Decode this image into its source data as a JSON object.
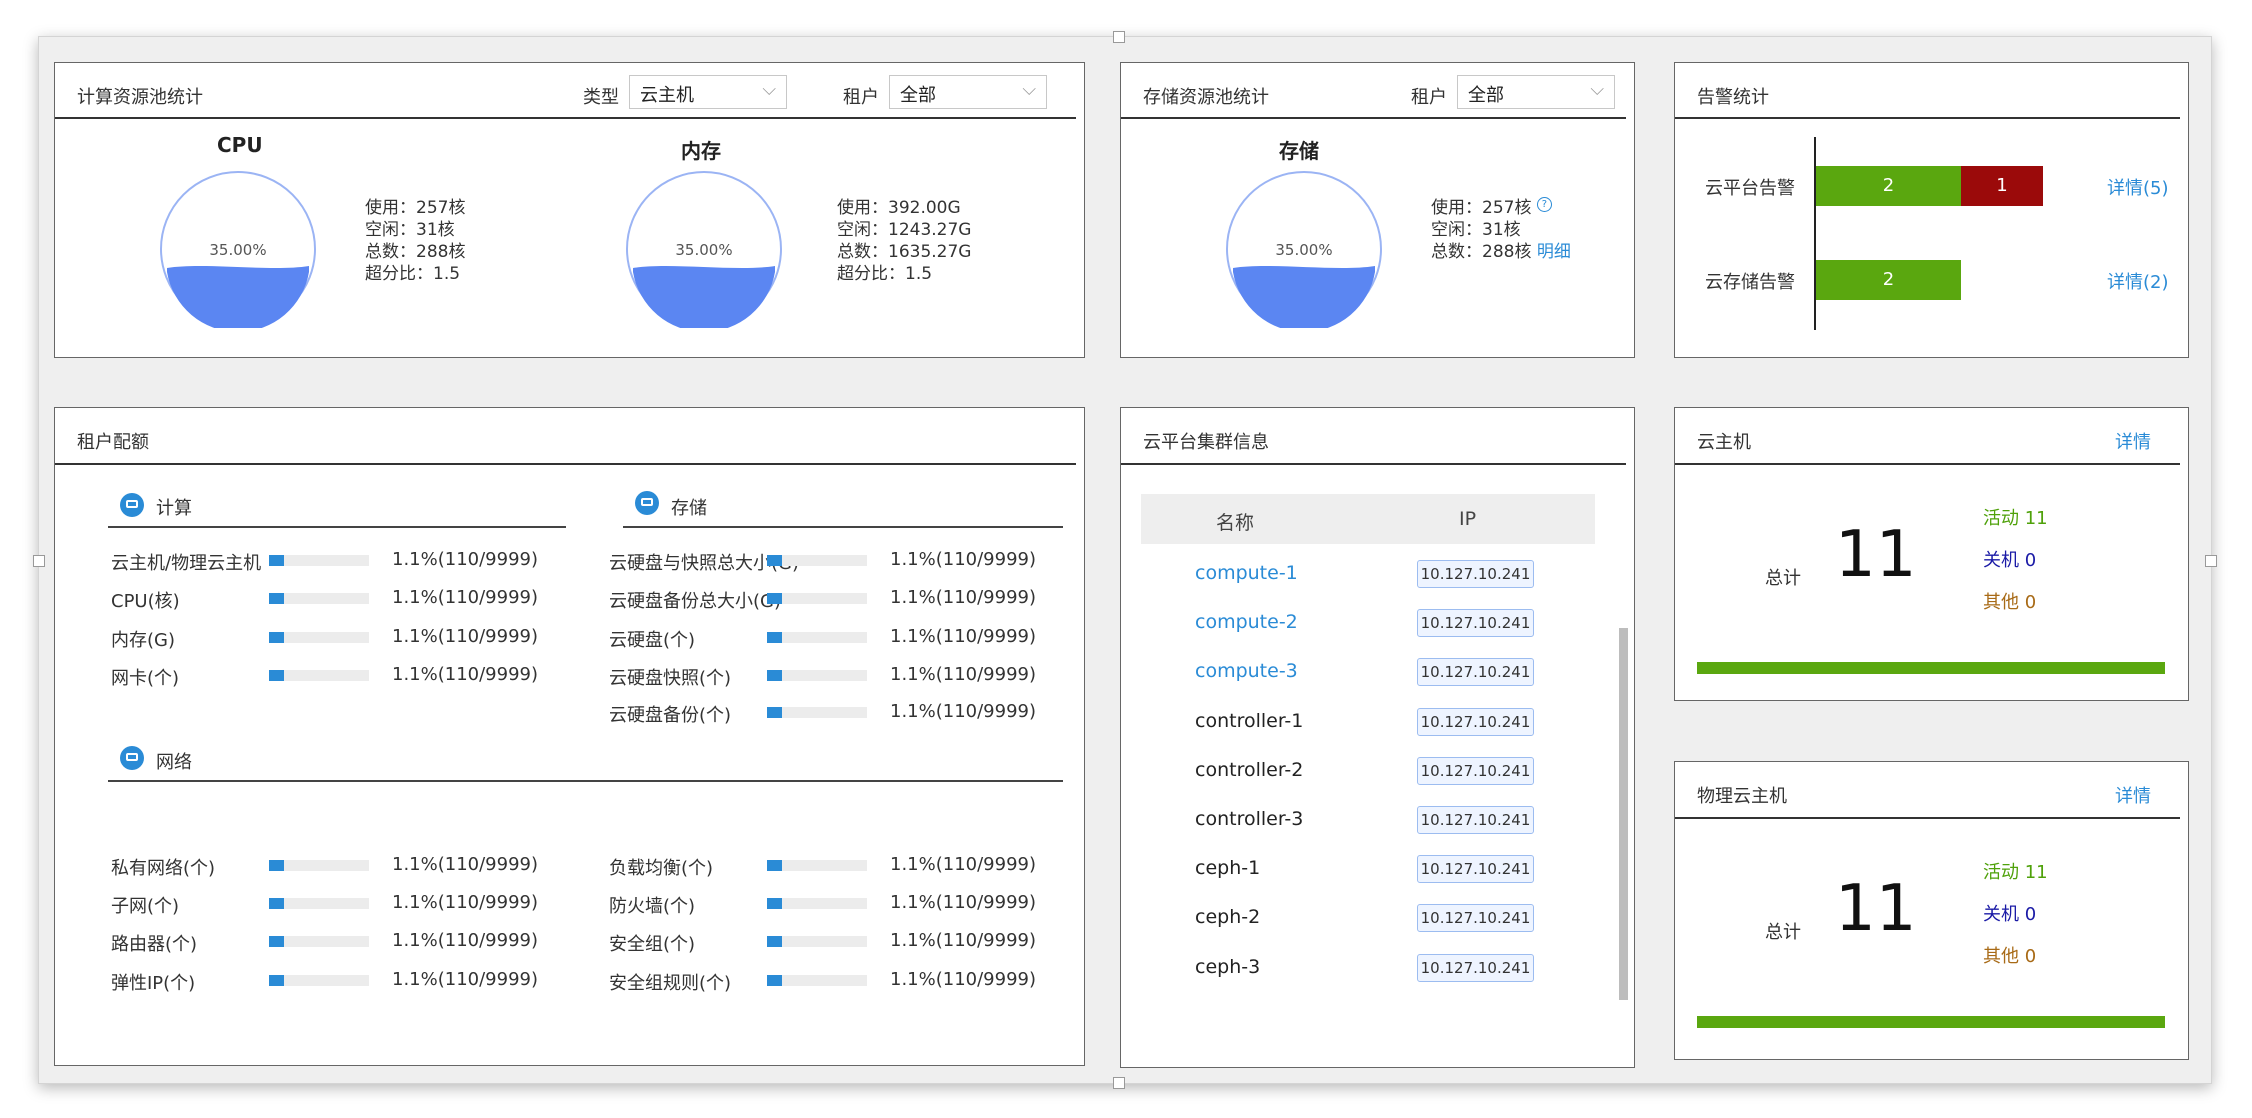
{
  "colors": {
    "accent": "#2a8bd6",
    "green": "#5aa70f",
    "darkred": "#9b0a0a",
    "gauge_fill": "#5b86f2",
    "status_active": "#4fa10a",
    "status_off": "#1a1aa6",
    "status_other": "#a86a16"
  },
  "compute_pool": {
    "title": "计算资源池统计",
    "type_label": "类型",
    "type_value": "云主机",
    "tenant_label": "租户",
    "tenant_value": "全部",
    "cpu": {
      "title": "CPU",
      "percent": "35.00%",
      "fill": 0.35,
      "used": "使用：257核",
      "idle": "空闲：31核",
      "total": "总数：288核",
      "ratio": "超分比：1.5"
    },
    "mem": {
      "title": "内存",
      "percent": "35.00%",
      "fill": 0.35,
      "used": "使用：392.00G",
      "idle": "空闲：1243.27G",
      "total": "总数：1635.27G",
      "ratio": "超分比：1.5"
    }
  },
  "storage_pool": {
    "title": "存储资源池统计",
    "tenant_label": "租户",
    "tenant_value": "全部",
    "storage": {
      "title": "存储",
      "percent": "35.00%",
      "fill": 0.35,
      "used": "使用：257核",
      "idle": "空闲：31核",
      "total": "总数：288核",
      "detail_link": "明细"
    }
  },
  "alerts": {
    "title": "告警统计",
    "rows": [
      {
        "label": "云平台告警",
        "green": 2,
        "red": 1,
        "detail": "详情(5)"
      },
      {
        "label": "云存储告警",
        "green": 2,
        "red": 0,
        "detail": "详情(2)"
      }
    ]
  },
  "quota": {
    "title": "租户配额",
    "compute": {
      "title": "计算",
      "items": [
        {
          "label": "云主机/物理云主机",
          "value": "1.1%(110/9999)",
          "fill": 0.15
        },
        {
          "label": "CPU(核)",
          "value": "1.1%(110/9999)",
          "fill": 0.15
        },
        {
          "label": "内存(G)",
          "value": "1.1%(110/9999)",
          "fill": 0.15
        },
        {
          "label": "网卡(个)",
          "value": "1.1%(110/9999)",
          "fill": 0.15
        }
      ]
    },
    "storage": {
      "title": "存储",
      "items": [
        {
          "label": "云硬盘与快照总大小(G)",
          "value": "1.1%(110/9999)",
          "fill": 0.15
        },
        {
          "label": "云硬盘备份总大小(G)",
          "value": "1.1%(110/9999)",
          "fill": 0.15
        },
        {
          "label": "云硬盘(个)",
          "value": "1.1%(110/9999)",
          "fill": 0.15
        },
        {
          "label": "云硬盘快照(个)",
          "value": "1.1%(110/9999)",
          "fill": 0.15
        },
        {
          "label": "云硬盘备份(个)",
          "value": "1.1%(110/9999)",
          "fill": 0.15
        }
      ]
    },
    "network": {
      "title": "网络",
      "left": [
        {
          "label": "私有网络(个)",
          "value": "1.1%(110/9999)",
          "fill": 0.15
        },
        {
          "label": "子网(个)",
          "value": "1.1%(110/9999)",
          "fill": 0.15
        },
        {
          "label": "路由器(个)",
          "value": "1.1%(110/9999)",
          "fill": 0.15
        },
        {
          "label": "弹性IP(个)",
          "value": "1.1%(110/9999)",
          "fill": 0.15
        }
      ],
      "right": [
        {
          "label": "负载均衡(个)",
          "value": "1.1%(110/9999)",
          "fill": 0.15
        },
        {
          "label": "防火墙(个)",
          "value": "1.1%(110/9999)",
          "fill": 0.15
        },
        {
          "label": "安全组(个)",
          "value": "1.1%(110/9999)",
          "fill": 0.15
        },
        {
          "label": "安全组规则(个)",
          "value": "1.1%(110/9999)",
          "fill": 0.15
        }
      ]
    }
  },
  "cluster": {
    "title": "云平台集群信息",
    "col_name": "名称",
    "col_ip": "IP",
    "rows": [
      {
        "name": "compute-1",
        "ip": "10.127.10.241",
        "link": true
      },
      {
        "name": "compute-2",
        "ip": "10.127.10.241",
        "link": true
      },
      {
        "name": "compute-3",
        "ip": "10.127.10.241",
        "link": true
      },
      {
        "name": "controller-1",
        "ip": "10.127.10.241",
        "link": false
      },
      {
        "name": "controller-2",
        "ip": "10.127.10.241",
        "link": false
      },
      {
        "name": "controller-3",
        "ip": "10.127.10.241",
        "link": false
      },
      {
        "name": "ceph-1",
        "ip": "10.127.10.241",
        "link": false
      },
      {
        "name": "ceph-2",
        "ip": "10.127.10.241",
        "link": false
      },
      {
        "name": "ceph-3",
        "ip": "10.127.10.241",
        "link": false
      }
    ]
  },
  "vm": {
    "title": "云主机",
    "detail": "详情",
    "total_label": "总计",
    "total": "11",
    "active": "活动 11",
    "off": "关机 0",
    "other": "其他 0"
  },
  "pm": {
    "title": "物理云主机",
    "detail": "详情",
    "total_label": "总计",
    "total": "11",
    "active": "活动 11",
    "off": "关机 0",
    "other": "其他 0"
  }
}
